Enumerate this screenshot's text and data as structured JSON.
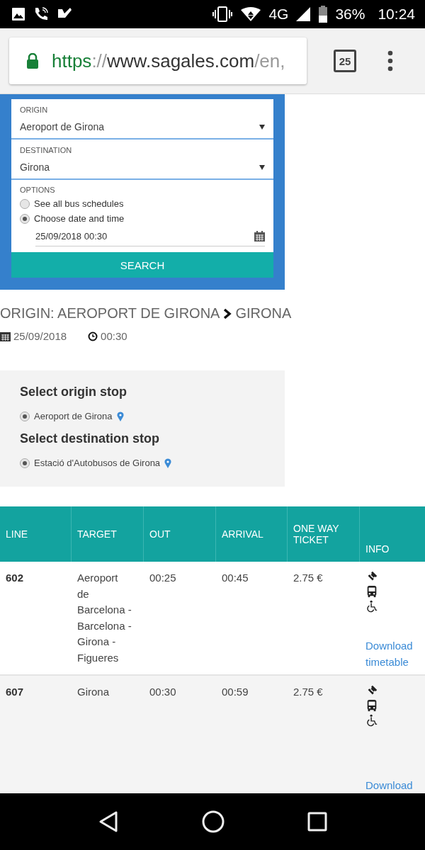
{
  "status_bar": {
    "network": "4G",
    "battery": "36%",
    "time": "10:24"
  },
  "browser": {
    "url": {
      "scheme": "https",
      "separator": "://",
      "host": "www.sagales.com",
      "path": "/en,"
    },
    "tab_count": "25"
  },
  "search_form": {
    "fields": [
      {
        "label": "ORIGIN",
        "value": "Aeroport de Girona"
      },
      {
        "label": "DESTINATION",
        "value": "Girona"
      }
    ],
    "options_label": "OPTIONS",
    "options": [
      {
        "label": "See all bus schedules",
        "selected": false
      },
      {
        "label": "Choose date and time",
        "selected": true
      }
    ],
    "datetime": "25/09/2018 00:30",
    "button": "SEARCH"
  },
  "result": {
    "origin": "ORIGIN: AEROPORT DE GIRONA",
    "destination": "GIRONA",
    "date": "25/09/2018",
    "time": "00:30"
  },
  "stops": [
    {
      "title": "Select origin stop",
      "options": [
        {
          "label": "Aeroport de Girona",
          "selected": true
        }
      ]
    },
    {
      "title": "Select destination stop",
      "options": [
        {
          "label": "Estació d'Autobusos de Girona",
          "selected": true
        }
      ]
    }
  ],
  "table": {
    "columns": [
      "LINE",
      "TARGET",
      "OUT",
      "ARRIVAL",
      "ONE WAY TICKET",
      "INFO"
    ],
    "rows": [
      {
        "line": "602",
        "target": "Aeroport de Barcelona - Barcelona - Girona - Figueres",
        "out": "00:25",
        "arrival": "00:45",
        "ticket": "2.75 €",
        "link": "Download timetable"
      },
      {
        "line": "607",
        "target": "Girona",
        "out": "00:30",
        "arrival": "00:59",
        "ticket": "2.75 €",
        "link": "Download"
      }
    ]
  }
}
